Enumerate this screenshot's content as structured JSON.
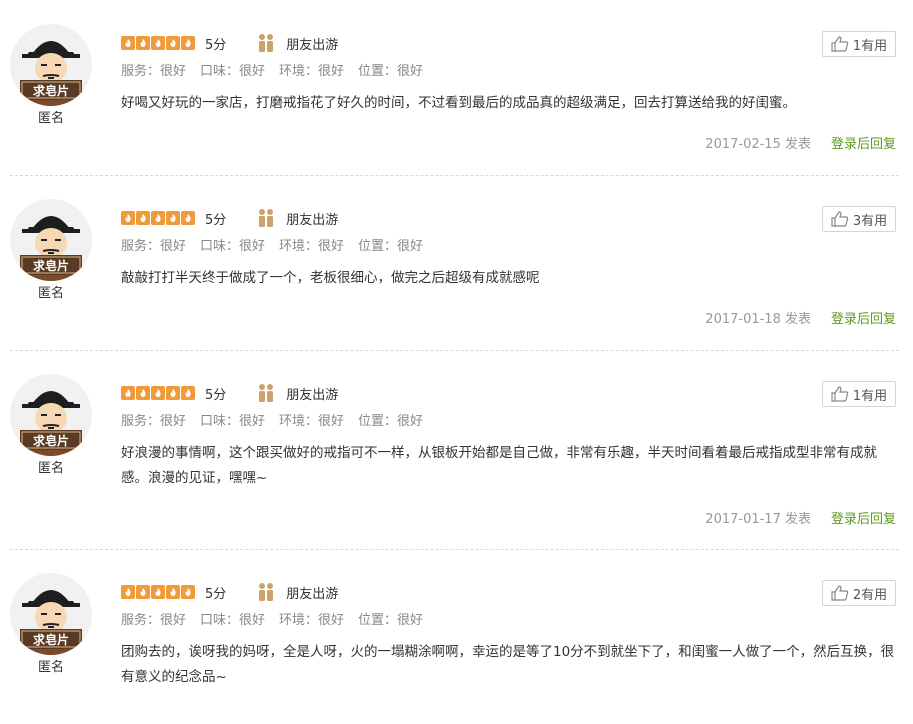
{
  "labels": {
    "useful_suffix": "有用",
    "posted_suffix": "发表",
    "reply_link": "登录后回复",
    "score_suffix": "分"
  },
  "colors": {
    "star": "#f09b3a",
    "reply_link": "#5b9a1d",
    "muted": "#999999"
  },
  "reviews": [
    {
      "avatar_text": "求皂片",
      "user_name": "匿名",
      "stars": 5,
      "score": "5分",
      "trip_type": "朋友出游",
      "sub_ratings": [
        "服务：很好",
        "口味：很好",
        "环境：很好",
        "位置：很好"
      ],
      "comment": "好喝又好玩的一家店，打磨戒指花了好久的时间，不过看到最后的成品真的超级满足，回去打算送给我的好闺蜜。",
      "useful": "1有用",
      "date": "2017-02-15 发表",
      "reply": "登录后回复"
    },
    {
      "avatar_text": "求皂片",
      "user_name": "匿名",
      "stars": 5,
      "score": "5分",
      "trip_type": "朋友出游",
      "sub_ratings": [
        "服务：很好",
        "口味：很好",
        "环境：很好",
        "位置：很好"
      ],
      "comment": "敲敲打打半天终于做成了一个，老板很细心，做完之后超级有成就感呢",
      "useful": "3有用",
      "date": "2017-01-18 发表",
      "reply": "登录后回复"
    },
    {
      "avatar_text": "求皂片",
      "user_name": "匿名",
      "stars": 5,
      "score": "5分",
      "trip_type": "朋友出游",
      "sub_ratings": [
        "服务：很好",
        "口味：很好",
        "环境：很好",
        "位置：很好"
      ],
      "comment": "好浪漫的事情啊，这个跟买做好的戒指可不一样，从银板开始都是自己做，非常有乐趣，半天时间看着最后戒指成型非常有成就感。浪漫的见证，嘿嘿~",
      "useful": "1有用",
      "date": "2017-01-17 发表",
      "reply": "登录后回复"
    },
    {
      "avatar_text": "求皂片",
      "user_name": "匿名",
      "stars": 5,
      "score": "5分",
      "trip_type": "朋友出游",
      "sub_ratings": [
        "服务：很好",
        "口味：很好",
        "环境：很好",
        "位置：很好"
      ],
      "comment": "团购去的，诶呀我的妈呀，全是人呀，火的一塌糊涂啊啊，幸运的是等了10分不到就坐下了，和闺蜜一人做了一个，然后互换，很有意义的纪念品~",
      "useful": "2有用",
      "date": "",
      "reply": ""
    }
  ]
}
